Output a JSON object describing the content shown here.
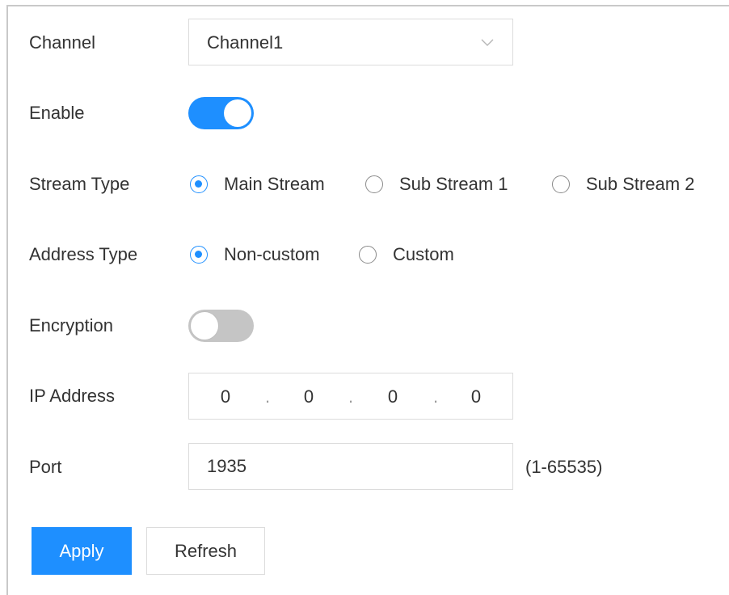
{
  "form": {
    "channel": {
      "label": "Channel",
      "value": "Channel1"
    },
    "enable": {
      "label": "Enable",
      "on": true
    },
    "stream_type": {
      "label": "Stream Type",
      "options": [
        "Main Stream",
        "Sub Stream 1",
        "Sub Stream 2"
      ],
      "selected": "Main Stream"
    },
    "address_type": {
      "label": "Address Type",
      "options": [
        "Non-custom",
        "Custom"
      ],
      "selected": "Non-custom"
    },
    "encryption": {
      "label": "Encryption",
      "on": false
    },
    "ip_address": {
      "label": "IP Address",
      "octets": [
        "0",
        "0",
        "0",
        "0"
      ],
      "separator": "."
    },
    "port": {
      "label": "Port",
      "value": "1935",
      "range_hint": "(1-65535)"
    }
  },
  "buttons": {
    "apply": "Apply",
    "refresh": "Refresh"
  },
  "colors": {
    "accent": "#1e8fff",
    "toggle_off": "#c5c5c5",
    "border": "#dcdcdc",
    "text": "#333333"
  },
  "icons": {
    "select_arrow": "chevron-down-icon"
  }
}
